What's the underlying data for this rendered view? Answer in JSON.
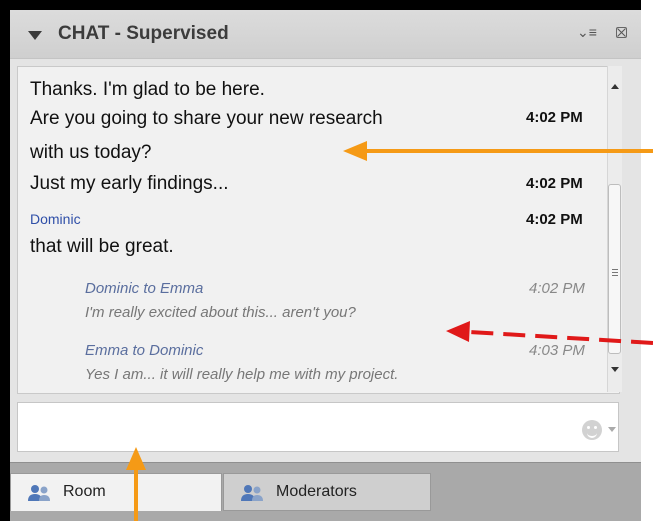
{
  "header": {
    "title": "CHAT - Supervised"
  },
  "messages": [
    {
      "text": "Thanks. I'm glad to be here.",
      "time": ""
    },
    {
      "text": "Are you going to share your new research",
      "time": "4:02 PM"
    },
    {
      "text": "with us today?",
      "time": ""
    },
    {
      "text": "Just my early findings...",
      "time": "4:02 PM"
    },
    {
      "name": "Dominic",
      "time": "4:02 PM"
    },
    {
      "text": "that will be great.",
      "time": ""
    }
  ],
  "private": [
    {
      "head": "Dominic to Emma",
      "text": "I'm really excited about this... aren't you?",
      "time": "4:02 PM"
    },
    {
      "head": "Emma to Dominic",
      "text": "Yes I am... it will really help me with my project.",
      "time": "4:03 PM"
    }
  ],
  "input": {
    "value": ""
  },
  "tabs": [
    {
      "label": "Room"
    },
    {
      "label": "Moderators"
    }
  ],
  "colors": {
    "annotation_orange": "#f59a16",
    "annotation_red": "#e01919"
  }
}
